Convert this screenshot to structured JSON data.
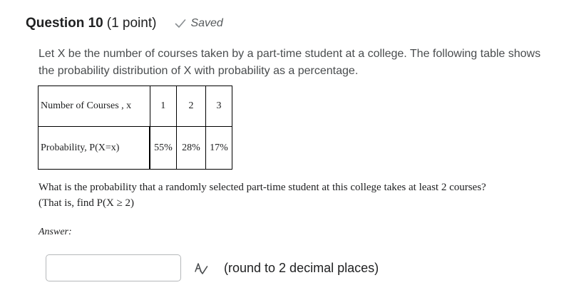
{
  "question": {
    "title": "Question 10",
    "points": "(1 point)",
    "status": "Saved",
    "status_icon": "checkmark-icon"
  },
  "intro_text": "Let X be the number of courses taken by a part-time student at a college. The following table shows the probability distribution of X with probability as a percentage.",
  "table": {
    "row1_label": "Number of Courses , x",
    "row2_label": "Probability, P(X=x)",
    "x_values": [
      "1",
      "2",
      "3"
    ],
    "probabilities": [
      "55%",
      "28%",
      "17%"
    ]
  },
  "question_text_line1": "What is the probability that a randomly selected part-time student at this college takes at least 2 courses?",
  "question_text_line2": "(That is, find P(X ≥ 2)",
  "answer": {
    "label": "Answer:",
    "value": "",
    "placeholder": "",
    "hint": "(round to 2 decimal places)",
    "format_icon": "spellcheck-icon"
  },
  "colors": {
    "text": "#202122",
    "muted_text": "#494c4e",
    "saved_text": "#565a5c",
    "input_border": "#b5b8ba"
  }
}
